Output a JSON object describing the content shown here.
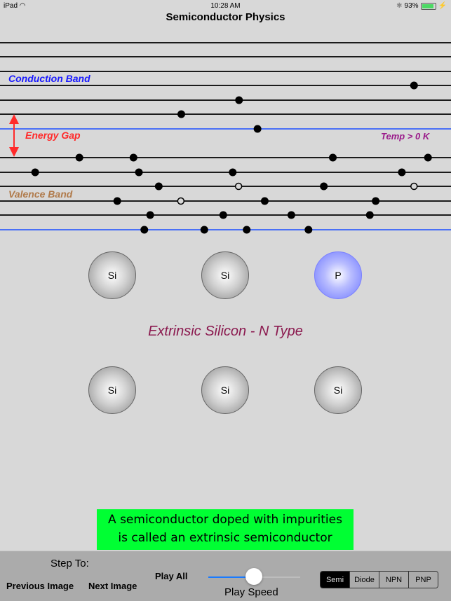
{
  "status_bar": {
    "device": "iPad",
    "time": "10:28 AM",
    "battery": "93%",
    "battery_level": 0.93
  },
  "header": {
    "title": "Semiconductor Physics"
  },
  "band_diagram": {
    "labels": {
      "conduction": "Conduction Band",
      "energy_gap": "Energy Gap",
      "valence": "Valence Band",
      "temperature": "Temp > 0 K"
    },
    "colors": {
      "conduction": "#1a1aff",
      "energy_gap": "#ff2a2a",
      "valence": "#b07a4a",
      "temperature": "#9a1a8a",
      "band_edge": "#1a4dff",
      "level": "#000000"
    },
    "levels": [
      {
        "band": "conduction",
        "edge": false,
        "electrons": [],
        "holes": []
      },
      {
        "band": "conduction",
        "edge": false,
        "electrons": [],
        "holes": []
      },
      {
        "band": "conduction",
        "edge": false,
        "electrons": [],
        "holes": []
      },
      {
        "band": "conduction",
        "edge": false,
        "electrons": [
          0.918
        ],
        "holes": []
      },
      {
        "band": "conduction",
        "edge": false,
        "electrons": [
          0.53
        ],
        "holes": []
      },
      {
        "band": "conduction",
        "edge": false,
        "electrons": [
          0.402
        ],
        "holes": []
      },
      {
        "band": "conduction",
        "edge": true,
        "electrons": [
          0.571
        ],
        "holes": []
      },
      {
        "band": "valence",
        "edge": false,
        "electrons": [
          0.176,
          0.296,
          0.738,
          0.949
        ],
        "holes": []
      },
      {
        "band": "valence",
        "edge": false,
        "electrons": [
          0.078,
          0.308,
          0.516,
          0.891
        ],
        "holes": []
      },
      {
        "band": "valence",
        "edge": false,
        "electrons": [
          0.352,
          0.718
        ],
        "holes": [
          0.529,
          0.918
        ]
      },
      {
        "band": "valence",
        "edge": false,
        "electrons": [
          0.26,
          0.587,
          0.833
        ],
        "holes": [
          0.401
        ]
      },
      {
        "band": "valence",
        "edge": false,
        "electrons": [
          0.333,
          0.495,
          0.646,
          0.82
        ],
        "holes": []
      },
      {
        "band": "valence",
        "edge": true,
        "electrons": [
          0.32,
          0.453,
          0.547,
          0.684
        ],
        "holes": []
      }
    ]
  },
  "lattice": {
    "row1": [
      {
        "symbol": "Si",
        "type": "si"
      },
      {
        "symbol": "Si",
        "type": "si"
      },
      {
        "symbol": "P",
        "type": "p"
      }
    ],
    "row2": [
      {
        "symbol": "Si",
        "type": "si"
      },
      {
        "symbol": "Si",
        "type": "si"
      },
      {
        "symbol": "Si",
        "type": "si"
      }
    ],
    "caption": "Extrinsic Silicon - N Type"
  },
  "info_box": {
    "line1": "A semiconductor doped with impurities",
    "line2": "is called an extrinsic semiconductor",
    "color": "#00ff33"
  },
  "toolbar": {
    "step_to_label": "Step To:",
    "previous_label": "Previous Image",
    "next_label": "Next Image",
    "play_all_label": "Play All",
    "play_speed_label": "Play Speed",
    "play_speed_value": 0.5,
    "segments": [
      {
        "label": "Semi",
        "active": true
      },
      {
        "label": "Diode",
        "active": false
      },
      {
        "label": "NPN",
        "active": false
      },
      {
        "label": "PNP",
        "active": false
      }
    ]
  }
}
